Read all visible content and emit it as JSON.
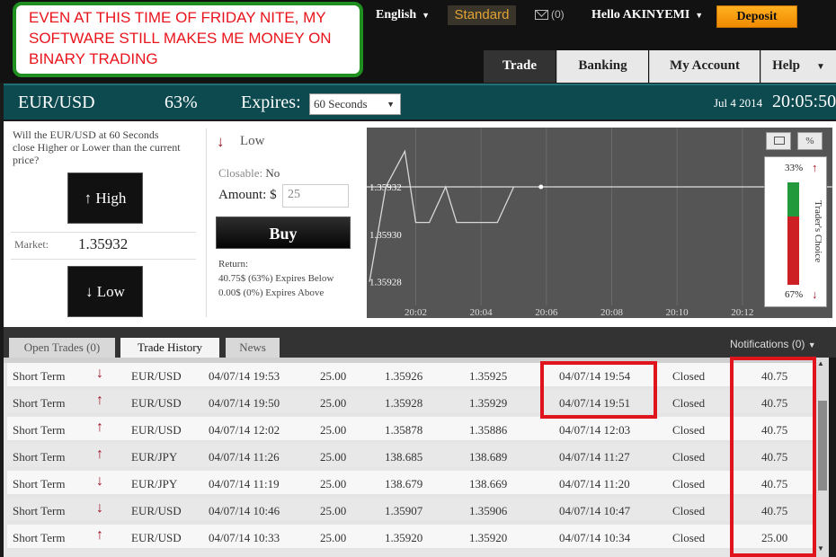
{
  "banner": {
    "text": "EVEN AT THIS TIME OF FRIDAY NITE, MY SOFTWARE STILL MAKES ME MONEY ON BINARY TRADING"
  },
  "topbar": {
    "language": "English",
    "account_type": "Standard",
    "messages": "(0)",
    "greeting": "Hello AKINYEMI",
    "deposit": "Deposit"
  },
  "nav": {
    "trade": "Trade",
    "banking": "Banking",
    "my_account": "My Account",
    "help": "Help"
  },
  "asset_bar": {
    "pair": "EUR/USD",
    "payout_pct": "63%",
    "expires_label": "Expires:",
    "expiry_selected": "60 Seconds",
    "date": "Jul 4 2014",
    "time": "20:05:50"
  },
  "trade_panel": {
    "question": "Will the EUR/USD at 60 Seconds close Higher or Lower than the current price?",
    "high": "High",
    "low": "Low",
    "market_label": "Market:",
    "market_value": "1.35932",
    "direction_label": "Low",
    "closable_label": "Closable:",
    "closable_value": "No",
    "amount_label": "Amount: $",
    "amount_value": "25",
    "buy": "Buy",
    "return_label": "Return:",
    "return_below": "40.75$ (63%) Expires Below",
    "return_above": "0.00$ (0%) Expires Above"
  },
  "chart_data": {
    "type": "line",
    "y_tick_labels": [
      "1.35932",
      "1.35930",
      "1.35928"
    ],
    "x_tick_labels": [
      "20:02",
      "20:04",
      "20:06",
      "20:08",
      "20:10",
      "20:12"
    ],
    "current_rate": 1.35932,
    "points": [
      {
        "x": "20:00:35",
        "y": 1.35928
      },
      {
        "x": "20:01:05",
        "y": 1.35932
      },
      {
        "x": "20:01:40",
        "y": 1.359335
      },
      {
        "x": "20:02:00",
        "y": 1.359305
      },
      {
        "x": "20:02:25",
        "y": 1.359305
      },
      {
        "x": "20:02:55",
        "y": 1.35932
      },
      {
        "x": "20:03:15",
        "y": 1.359305
      },
      {
        "x": "20:04:30",
        "y": 1.359305
      },
      {
        "x": "20:05:00",
        "y": 1.35932
      },
      {
        "x": "20:05:50",
        "y": 1.35932
      }
    ],
    "ylim": [
      1.35927,
      1.359345
    ],
    "xlim": [
      "20:00:30",
      "20:12:30"
    ],
    "colors": {
      "background": "#555555",
      "line": "#d8d8d8",
      "grid": "#6a6a6a",
      "current_line": "#ffffff"
    }
  },
  "traders_choice": {
    "label": "Trader's Choice",
    "top_pct": "33%",
    "bottom_pct": "67%",
    "up_fraction": 0.33,
    "down_fraction": 0.67,
    "up_color": "#229a3c",
    "down_color": "#cc2024"
  },
  "history_tabs": {
    "open_trades": "Open Trades (0)",
    "trade_history": "Trade History",
    "news": "News",
    "notifications": "Notifications (0)"
  },
  "trade_history": [
    {
      "term": "Short Term",
      "direction": "down",
      "pair": "EUR/USD",
      "opened": "04/07/14 19:53",
      "amount": "25.00",
      "entry": "1.35926",
      "exit": "1.35925",
      "closed_at": "04/07/14 19:54",
      "status": "Closed",
      "payout": "40.75"
    },
    {
      "term": "Short Term",
      "direction": "up",
      "pair": "EUR/USD",
      "opened": "04/07/14 19:50",
      "amount": "25.00",
      "entry": "1.35928",
      "exit": "1.35929",
      "closed_at": "04/07/14 19:51",
      "status": "Closed",
      "payout": "40.75"
    },
    {
      "term": "Short Term",
      "direction": "up",
      "pair": "EUR/USD",
      "opened": "04/07/14 12:02",
      "amount": "25.00",
      "entry": "1.35878",
      "exit": "1.35886",
      "closed_at": "04/07/14 12:03",
      "status": "Closed",
      "payout": "40.75"
    },
    {
      "term": "Short Term",
      "direction": "up",
      "pair": "EUR/JPY",
      "opened": "04/07/14 11:26",
      "amount": "25.00",
      "entry": "138.685",
      "exit": "138.689",
      "closed_at": "04/07/14 11:27",
      "status": "Closed",
      "payout": "40.75"
    },
    {
      "term": "Short Term",
      "direction": "down",
      "pair": "EUR/JPY",
      "opened": "04/07/14 11:19",
      "amount": "25.00",
      "entry": "138.679",
      "exit": "138.669",
      "closed_at": "04/07/14 11:20",
      "status": "Closed",
      "payout": "40.75"
    },
    {
      "term": "Short Term",
      "direction": "down",
      "pair": "EUR/USD",
      "opened": "04/07/14 10:46",
      "amount": "25.00",
      "entry": "1.35907",
      "exit": "1.35906",
      "closed_at": "04/07/14 10:47",
      "status": "Closed",
      "payout": "40.75"
    },
    {
      "term": "Short Term",
      "direction": "up",
      "pair": "EUR/USD",
      "opened": "04/07/14 10:33",
      "amount": "25.00",
      "entry": "1.35920",
      "exit": "1.35920",
      "closed_at": "04/07/14 10:34",
      "status": "Closed",
      "payout": "25.00"
    }
  ],
  "colors": {
    "accent_orange": "#f39a10",
    "teal_bar": "#0d4a50",
    "arrow_red": "#a01525",
    "highlight_red": "#e0141c",
    "banner_green": "#1f8f1f"
  }
}
